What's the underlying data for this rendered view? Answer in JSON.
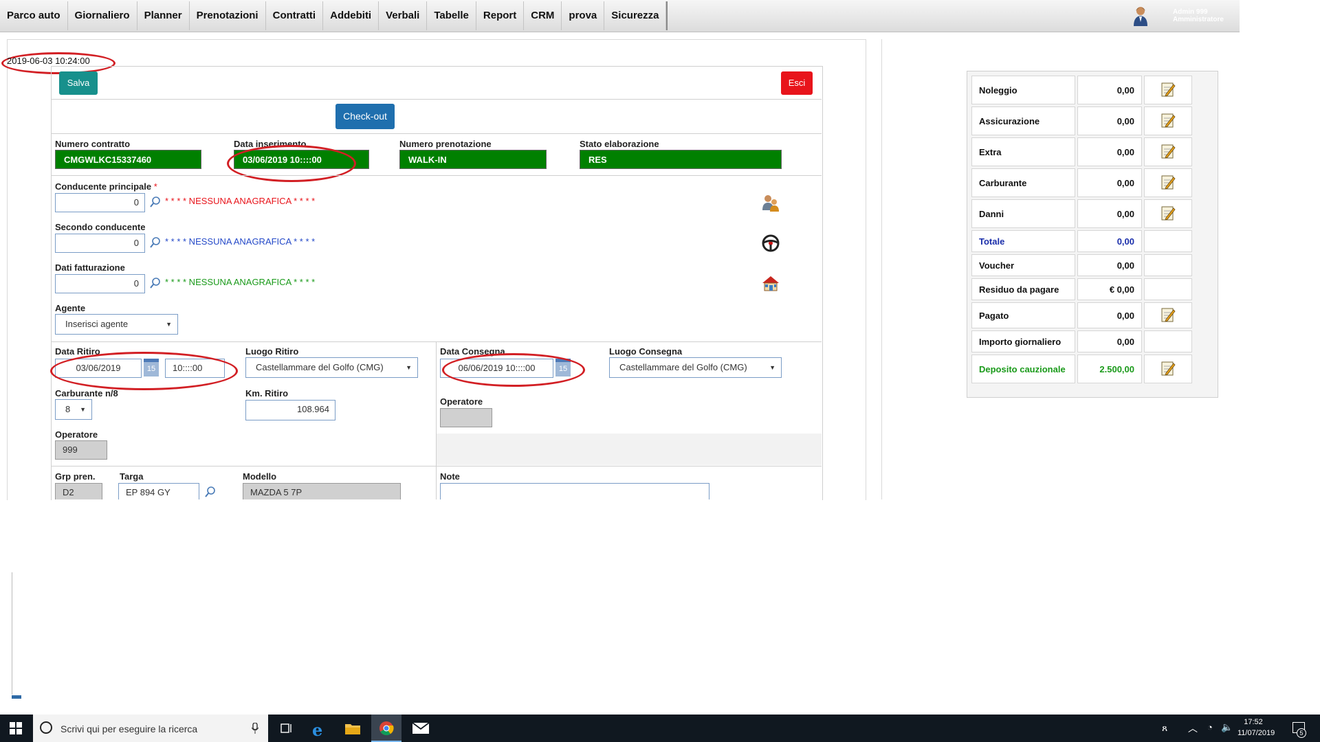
{
  "menu": [
    "Parco auto",
    "Giornaliero",
    "Planner",
    "Prenotazioni",
    "Contratti",
    "Addebiti",
    "Verbali",
    "Tabelle",
    "Report",
    "CRM",
    "prova",
    "Sicurezza"
  ],
  "user": {
    "name": "Admin 999",
    "role": "Amministratore"
  },
  "timestamp": "2019-06-03 10:24:00",
  "buttons": {
    "save": "Salva",
    "exit": "Esci",
    "checkout": "Check-out"
  },
  "contract": {
    "numero_label": "Numero contratto",
    "numero_value": "CMGWLKC15337460",
    "data_ins_label": "Data inserimento",
    "data_ins_value": "03/06/2019 10::::00",
    "prenotazione_label": "Numero prenotazione",
    "prenotazione_value": "WALK-IN",
    "stato_label": "Stato elaborazione",
    "stato_value": "RES"
  },
  "drivers": {
    "primary_label": "Conducente principale",
    "required_mark": "*",
    "primary_value": "0",
    "primary_text": "* * * * NESSUNA ANAGRAFICA * * * *",
    "second_label": "Secondo conducente",
    "second_value": "0",
    "second_text": "* * * * NESSUNA ANAGRAFICA * * * *",
    "billing_label": "Dati fatturazione",
    "billing_value": "0",
    "billing_text": "* * * * NESSUNA ANAGRAFICA * * * *",
    "agent_label": "Agente",
    "agent_value": "Inserisci agente"
  },
  "pickup": {
    "date_label": "Data Ritiro",
    "date_value": "03/06/2019",
    "time_value": "10::::00",
    "calendar_day": "15",
    "place_label": "Luogo Ritiro",
    "place_value": "Castellammare del Golfo (CMG)",
    "fuel_label": "Carburante n/8",
    "fuel_value": "8",
    "km_label": "Km. Ritiro",
    "km_value": "108.964",
    "operator_label": "Operatore",
    "operator_value": "999"
  },
  "delivery": {
    "date_label": "Data Consegna",
    "date_value": "06/06/2019 10::::00",
    "calendar_day": "15",
    "place_label": "Luogo Consegna",
    "place_value": "Castellammare del Golfo (CMG)",
    "operator_label": "Operatore",
    "operator_value": ""
  },
  "vehicle": {
    "group_label": "Grp pren.",
    "group_value": "D2",
    "plate_label": "Targa",
    "plate_value": "EP 894 GY",
    "model_label": "Modello",
    "model_value": "MAZDA 5 7P",
    "note_label": "Note"
  },
  "summary": [
    {
      "label": "Noleggio",
      "value": "0,00",
      "edit": true
    },
    {
      "label": "Assicurazione",
      "value": "0,00",
      "edit": true
    },
    {
      "label": "Extra",
      "value": "0,00",
      "edit": true
    },
    {
      "label": "Carburante",
      "value": "0,00",
      "edit": true
    },
    {
      "label": "Danni",
      "value": "0,00",
      "edit": true
    },
    {
      "label": "Totale",
      "value": "0,00",
      "edit": false
    },
    {
      "label": "Voucher",
      "value": "0,00",
      "edit": false
    },
    {
      "label": "Residuo da pagare",
      "value": "€ 0,00",
      "edit": false
    },
    {
      "label": "Pagato",
      "value": "0,00",
      "edit": true
    },
    {
      "label": "Importo giornaliero",
      "value": "0,00",
      "edit": false
    },
    {
      "label": "Deposito cauzionale",
      "value": "2.500,00",
      "edit": true
    }
  ],
  "colors": {
    "green": "#008000",
    "teal": "#17908c",
    "blue_button": "#1f6fae",
    "red": "#e8141b",
    "total_blue": "#1a2eaa",
    "deposit_green": "#1a9a1a"
  },
  "taskbar": {
    "search_placeholder": "Scrivi qui per eseguire la ricerca",
    "time": "17:52",
    "date": "11/07/2019",
    "notifications": "5"
  }
}
